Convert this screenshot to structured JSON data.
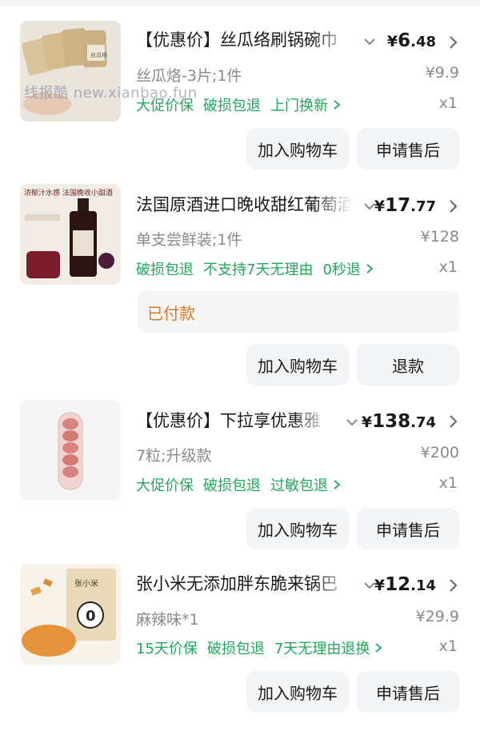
{
  "watermark": "线报酷 new.xianbao.fun",
  "items": [
    {
      "title": "【优惠价】丝瓜络刷锅碗巾",
      "price": {
        "currency": "¥",
        "int": "6",
        "dec": ".48"
      },
      "spec": "丝瓜烙-3片;1件",
      "orig_price": "¥9.9",
      "tags": [
        "大促价保",
        "破损包退",
        "上门换新"
      ],
      "qty": "x1",
      "thumb_text": "丝瓜络",
      "buttons": [
        "加入购物车",
        "申请售后"
      ]
    },
    {
      "title": "法国原酒进口晚收甜红葡萄酒",
      "price": {
        "currency": "¥",
        "int": "17",
        "dec": ".77"
      },
      "spec": "单支尝鲜装;1件",
      "orig_price": "¥128",
      "tags": [
        "破损包退",
        "不支持7天无理由",
        "0秒退"
      ],
      "qty": "x1",
      "status": "已付款",
      "thumb_text": "浓郁汁水感 法国晚收小甜酒",
      "buttons": [
        "加入购物车",
        "退款"
      ]
    },
    {
      "title": "【优惠价】下拉享优惠雅",
      "price": {
        "currency": "¥",
        "int": "138",
        "dec": ".74"
      },
      "spec": "7粒;升级款",
      "orig_price": "¥200",
      "tags": [
        "大促价保",
        "破损包退",
        "过敏包退"
      ],
      "qty": "x1",
      "buttons": [
        "加入购物车",
        "申请售后"
      ]
    },
    {
      "title": "张小米无添加胖东脆来锅巴",
      "price": {
        "currency": "¥",
        "int": "12",
        "dec": ".14"
      },
      "spec": "麻辣味*1",
      "orig_price": "¥29.9",
      "tags": [
        "15天价保",
        "破损包退",
        "7天无理由退换"
      ],
      "qty": "x1",
      "thumb_text": "张小米",
      "buttons": [
        "加入购物车",
        "申请售后"
      ]
    }
  ],
  "colors": {
    "tag_green": "#21a85b",
    "paid_orange": "#e07a1f",
    "button_bg": "#f3f4f6"
  }
}
